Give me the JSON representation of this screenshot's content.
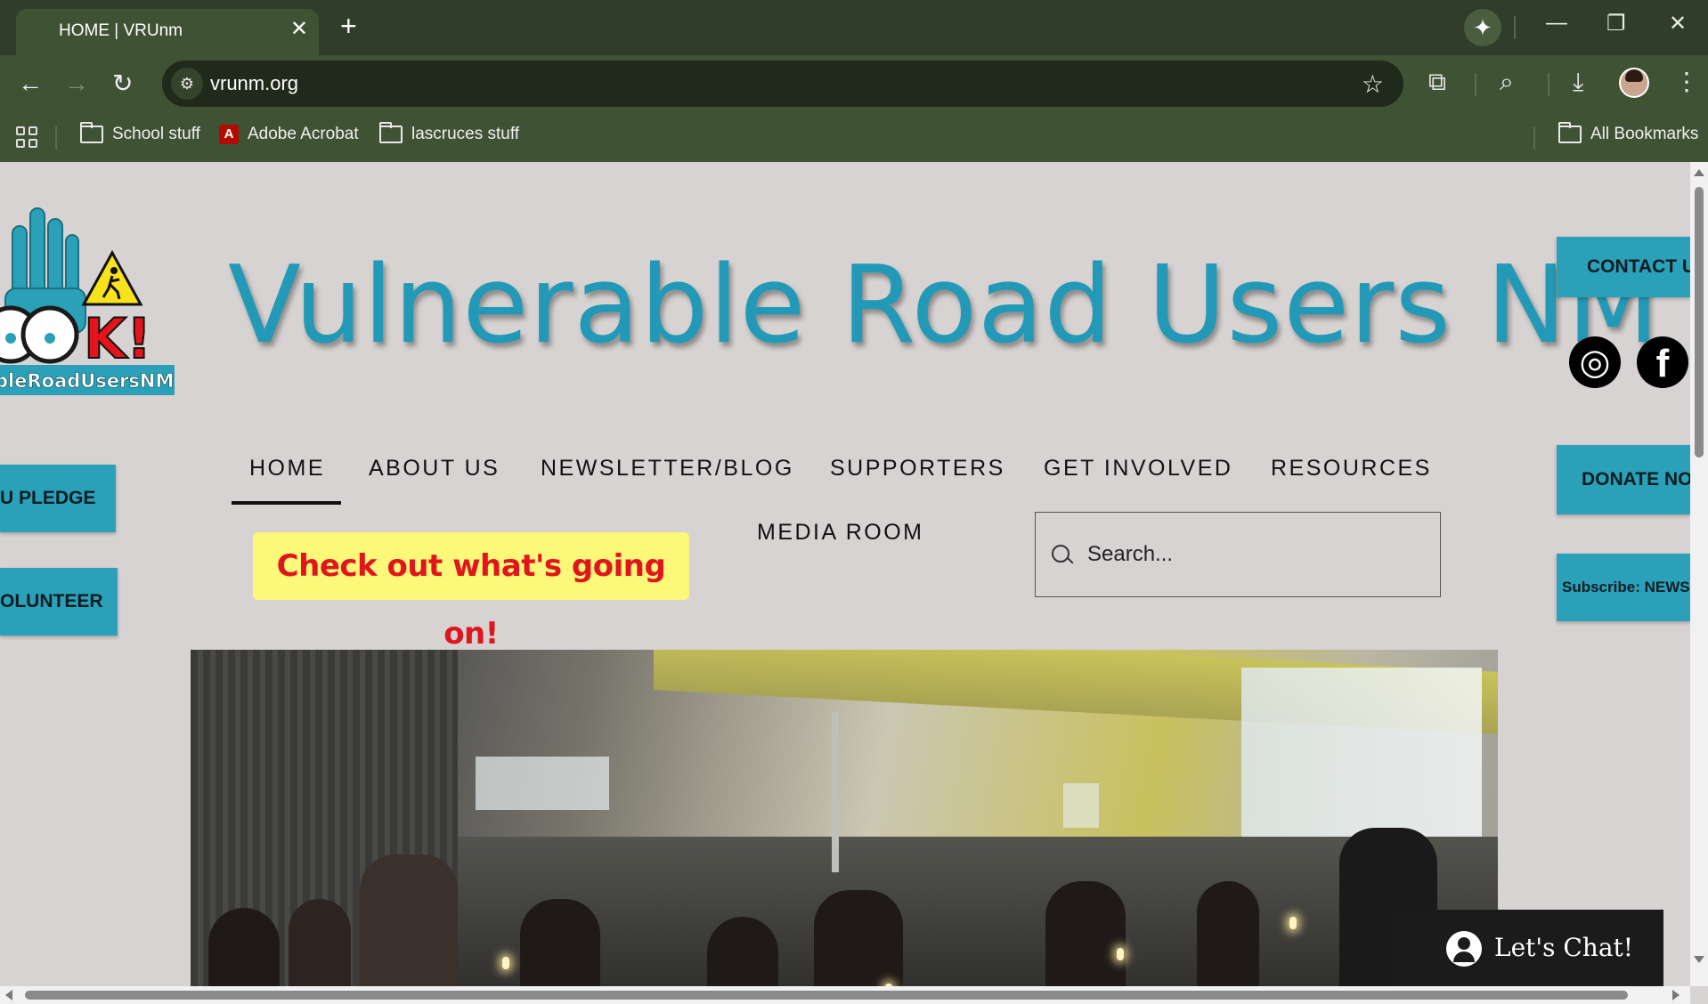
{
  "browser": {
    "tab_title": "HOME | VRUnm",
    "tab_close": "✕",
    "new_tab": "+",
    "url": "vrunm.org",
    "bookmarks": [
      {
        "label": "School stuff",
        "icon": "folder-icon"
      },
      {
        "label": "Adobe Acrobat",
        "icon": "acrobat-icon"
      },
      {
        "label": "lascruces stuff",
        "icon": "folder-icon"
      }
    ],
    "all_bookmarks": "All Bookmarks",
    "glyphs": {
      "back": "←",
      "forward": "→",
      "reload": "↻",
      "star": "☆",
      "gemini": "✦",
      "minimize": "—",
      "restore": "❐",
      "close": "✕",
      "extensions": "⧉",
      "download": "⤓",
      "menu": "⋮",
      "site_info": "⚙",
      "tabsearch": "⌕",
      "acrobat": "A"
    }
  },
  "site": {
    "title": "Vulnerable Road Users NM",
    "logo_text": "bleRoadUsersNM",
    "logo_bang": "K!",
    "side_left_buttons": [
      "U PLEDGE",
      "OLUNTEER"
    ],
    "side_right_buttons": {
      "contact": "CONTACT US",
      "donate": "DONATE NOW",
      "subscribe": "Subscribe: NEWSLETTER"
    },
    "social": {
      "instagram": "◎",
      "facebook": "f"
    },
    "nav": [
      "HOME",
      "ABOUT US",
      "NEWSLETTER/BLOG",
      "SUPPORTERS",
      "GET INVOLVED",
      "RESOURCES",
      "MEDIA ROOM"
    ],
    "promo": "Check out what's going on!",
    "search_placeholder": "Search...",
    "chat_label": "Let's Chat!"
  },
  "colors": {
    "brand_teal": "#2299b6",
    "button_teal": "#2aa1b8",
    "promo_bg": "#fdf77a",
    "promo_text": "#e0151d",
    "page_bg": "#d8d3d3",
    "chrome_bg": "#2f3d2a"
  }
}
